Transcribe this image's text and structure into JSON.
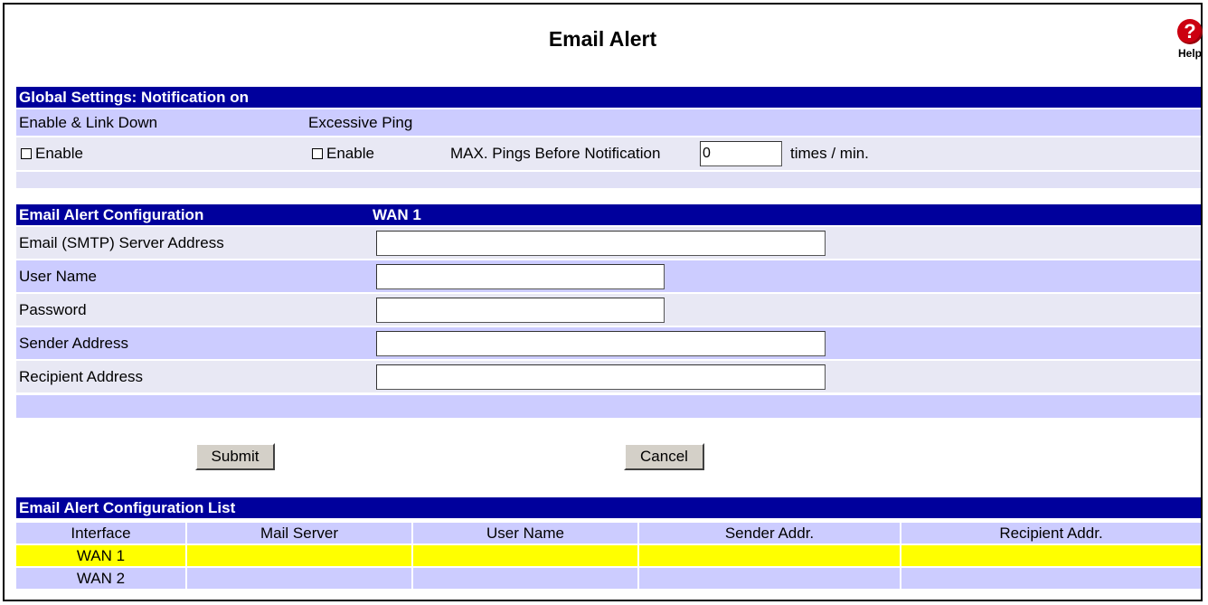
{
  "page": {
    "title": "Email Alert",
    "help_label": "Help",
    "help_glyph": "?"
  },
  "global": {
    "header": "Global Settings: Notification on",
    "col1_label": "Enable & Link Down",
    "col2_label": "Excessive Ping",
    "enable1": "Enable",
    "enable2": "Enable",
    "max_pings_label": "MAX. Pings Before Notification",
    "max_pings_value": "0",
    "units": "times / min."
  },
  "config": {
    "header": "Email Alert Configuration",
    "wan_header": "WAN 1",
    "fields": {
      "smtp": {
        "label": "Email (SMTP) Server Address",
        "value": ""
      },
      "user": {
        "label": "User Name",
        "value": ""
      },
      "password": {
        "label": "Password",
        "value": ""
      },
      "sender": {
        "label": "Sender Address",
        "value": ""
      },
      "recipient": {
        "label": "Recipient Address",
        "value": ""
      }
    }
  },
  "buttons": {
    "submit": "Submit",
    "cancel": "Cancel"
  },
  "list": {
    "header": "Email Alert Configuration List",
    "columns": [
      "Interface",
      "Mail Server",
      "User Name",
      "Sender Addr.",
      "Recipient Addr."
    ],
    "rows": [
      [
        "WAN 1",
        "",
        "",
        "",
        ""
      ],
      [
        "WAN 2",
        "",
        "",
        "",
        ""
      ]
    ]
  },
  "colors": {
    "header_bg": "#00009c",
    "row_bg": "#ccccff",
    "highlight": "#ffff00",
    "help_icon": "#cc0010"
  }
}
